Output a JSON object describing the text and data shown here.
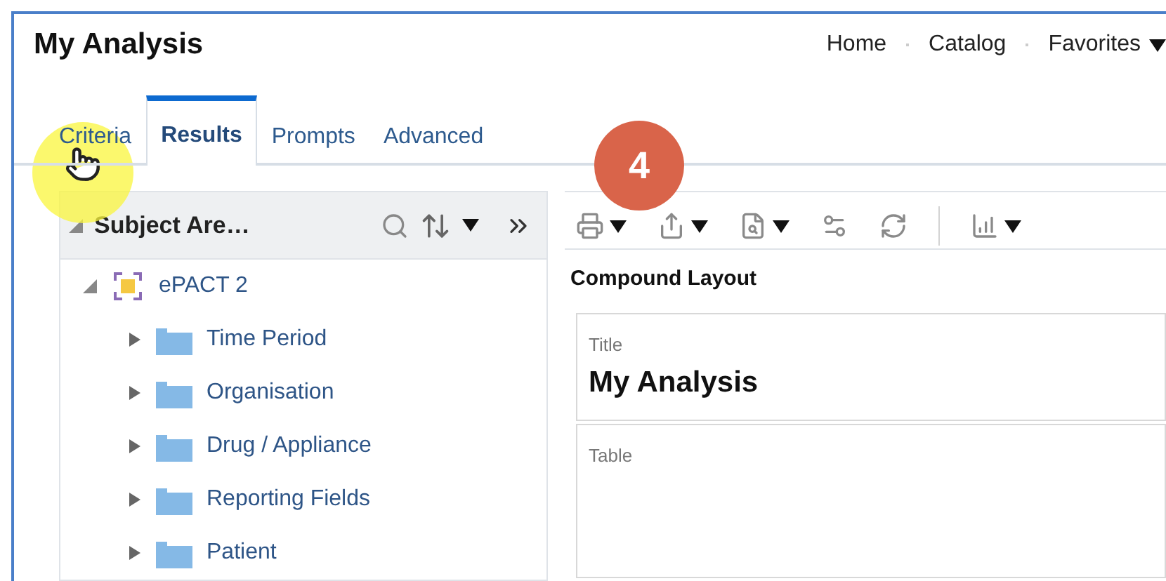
{
  "title": "My Analysis",
  "nav": [
    {
      "label": "Home",
      "caret": false
    },
    {
      "label": "Catalog",
      "caret": false
    },
    {
      "label": "Favorites",
      "caret": true
    }
  ],
  "tabs": [
    {
      "label": "Criteria",
      "selected": false
    },
    {
      "label": "Results",
      "selected": true
    },
    {
      "label": "Prompts",
      "selected": false
    },
    {
      "label": "Advanced",
      "selected": false
    }
  ],
  "step_badge": "4",
  "subject_panel": {
    "title": "Subject Are…",
    "expanded": true,
    "tree": [
      {
        "label": "ePACT 2",
        "kind": "subject",
        "expanded": true,
        "children": [
          {
            "label": "Time Period",
            "kind": "folder",
            "expanded": false
          },
          {
            "label": "Organisation",
            "kind": "folder",
            "expanded": false
          },
          {
            "label": "Drug / Appliance",
            "kind": "folder",
            "expanded": false
          },
          {
            "label": "Reporting Fields",
            "kind": "folder",
            "expanded": false
          },
          {
            "label": "Patient",
            "kind": "folder",
            "expanded": false
          }
        ]
      }
    ]
  },
  "toolbar": [
    {
      "kind": "print",
      "caret": true
    },
    {
      "kind": "export",
      "caret": true
    },
    {
      "kind": "preview",
      "caret": true
    },
    {
      "kind": "print-settings",
      "caret": false
    },
    {
      "kind": "refresh",
      "caret": false
    },
    {
      "kind": "add-view",
      "caret": true
    }
  ],
  "layout": {
    "heading": "Compound Layout",
    "views": [
      {
        "kind": "title",
        "caption": "Title",
        "value": "My Analysis"
      },
      {
        "kind": "table",
        "caption": "Table"
      }
    ]
  }
}
